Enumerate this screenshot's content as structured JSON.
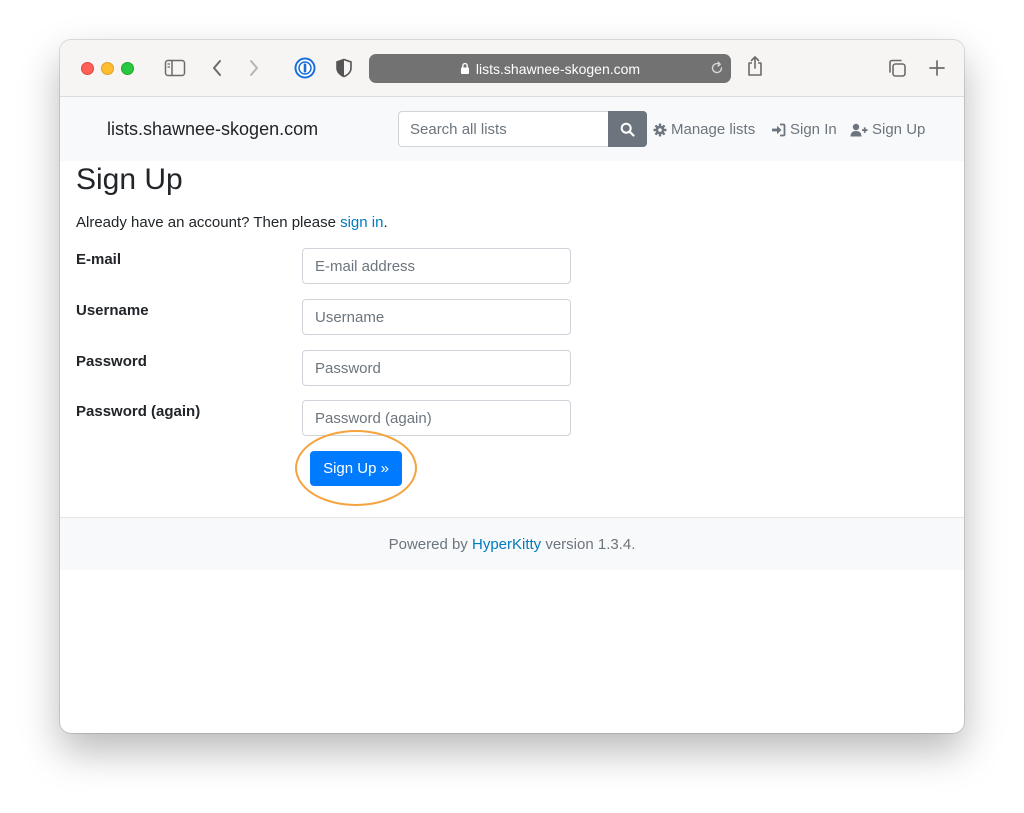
{
  "browser": {
    "url": "lists.shawnee-skogen.com",
    "icons": {
      "sidebar": "sidebar-icon",
      "back": "chevron-left-icon",
      "forward": "chevron-right-icon",
      "password_manager": "1password-icon",
      "privacy": "shield-icon",
      "lock": "lock-icon",
      "reload": "reload-icon",
      "share": "share-icon",
      "tabs": "tabs-overview-icon",
      "new_tab": "plus-icon"
    }
  },
  "navbar": {
    "brand": "lists.shawnee-skogen.com",
    "search_placeholder": "Search all lists",
    "links": {
      "manage": "Manage lists",
      "sign_in": "Sign In",
      "sign_up": "Sign Up"
    }
  },
  "page": {
    "title": "Sign Up",
    "already_prefix": "Already have an account? Then please ",
    "already_link": "sign in",
    "already_suffix": ".",
    "fields": [
      {
        "label": "E-mail",
        "placeholder": "E-mail address"
      },
      {
        "label": "Username",
        "placeholder": "Username"
      },
      {
        "label": "Password",
        "placeholder": "Password"
      },
      {
        "label": "Password (again)",
        "placeholder": "Password (again)"
      }
    ],
    "submit_label": "Sign Up »"
  },
  "footer": {
    "prefix": "Powered by ",
    "link": "HyperKitty",
    "suffix": " version 1.3.4."
  },
  "colors": {
    "primary": "#007bff",
    "link": "#007bbd",
    "highlight": "#f5a33c",
    "search_button": "#6c757d"
  }
}
